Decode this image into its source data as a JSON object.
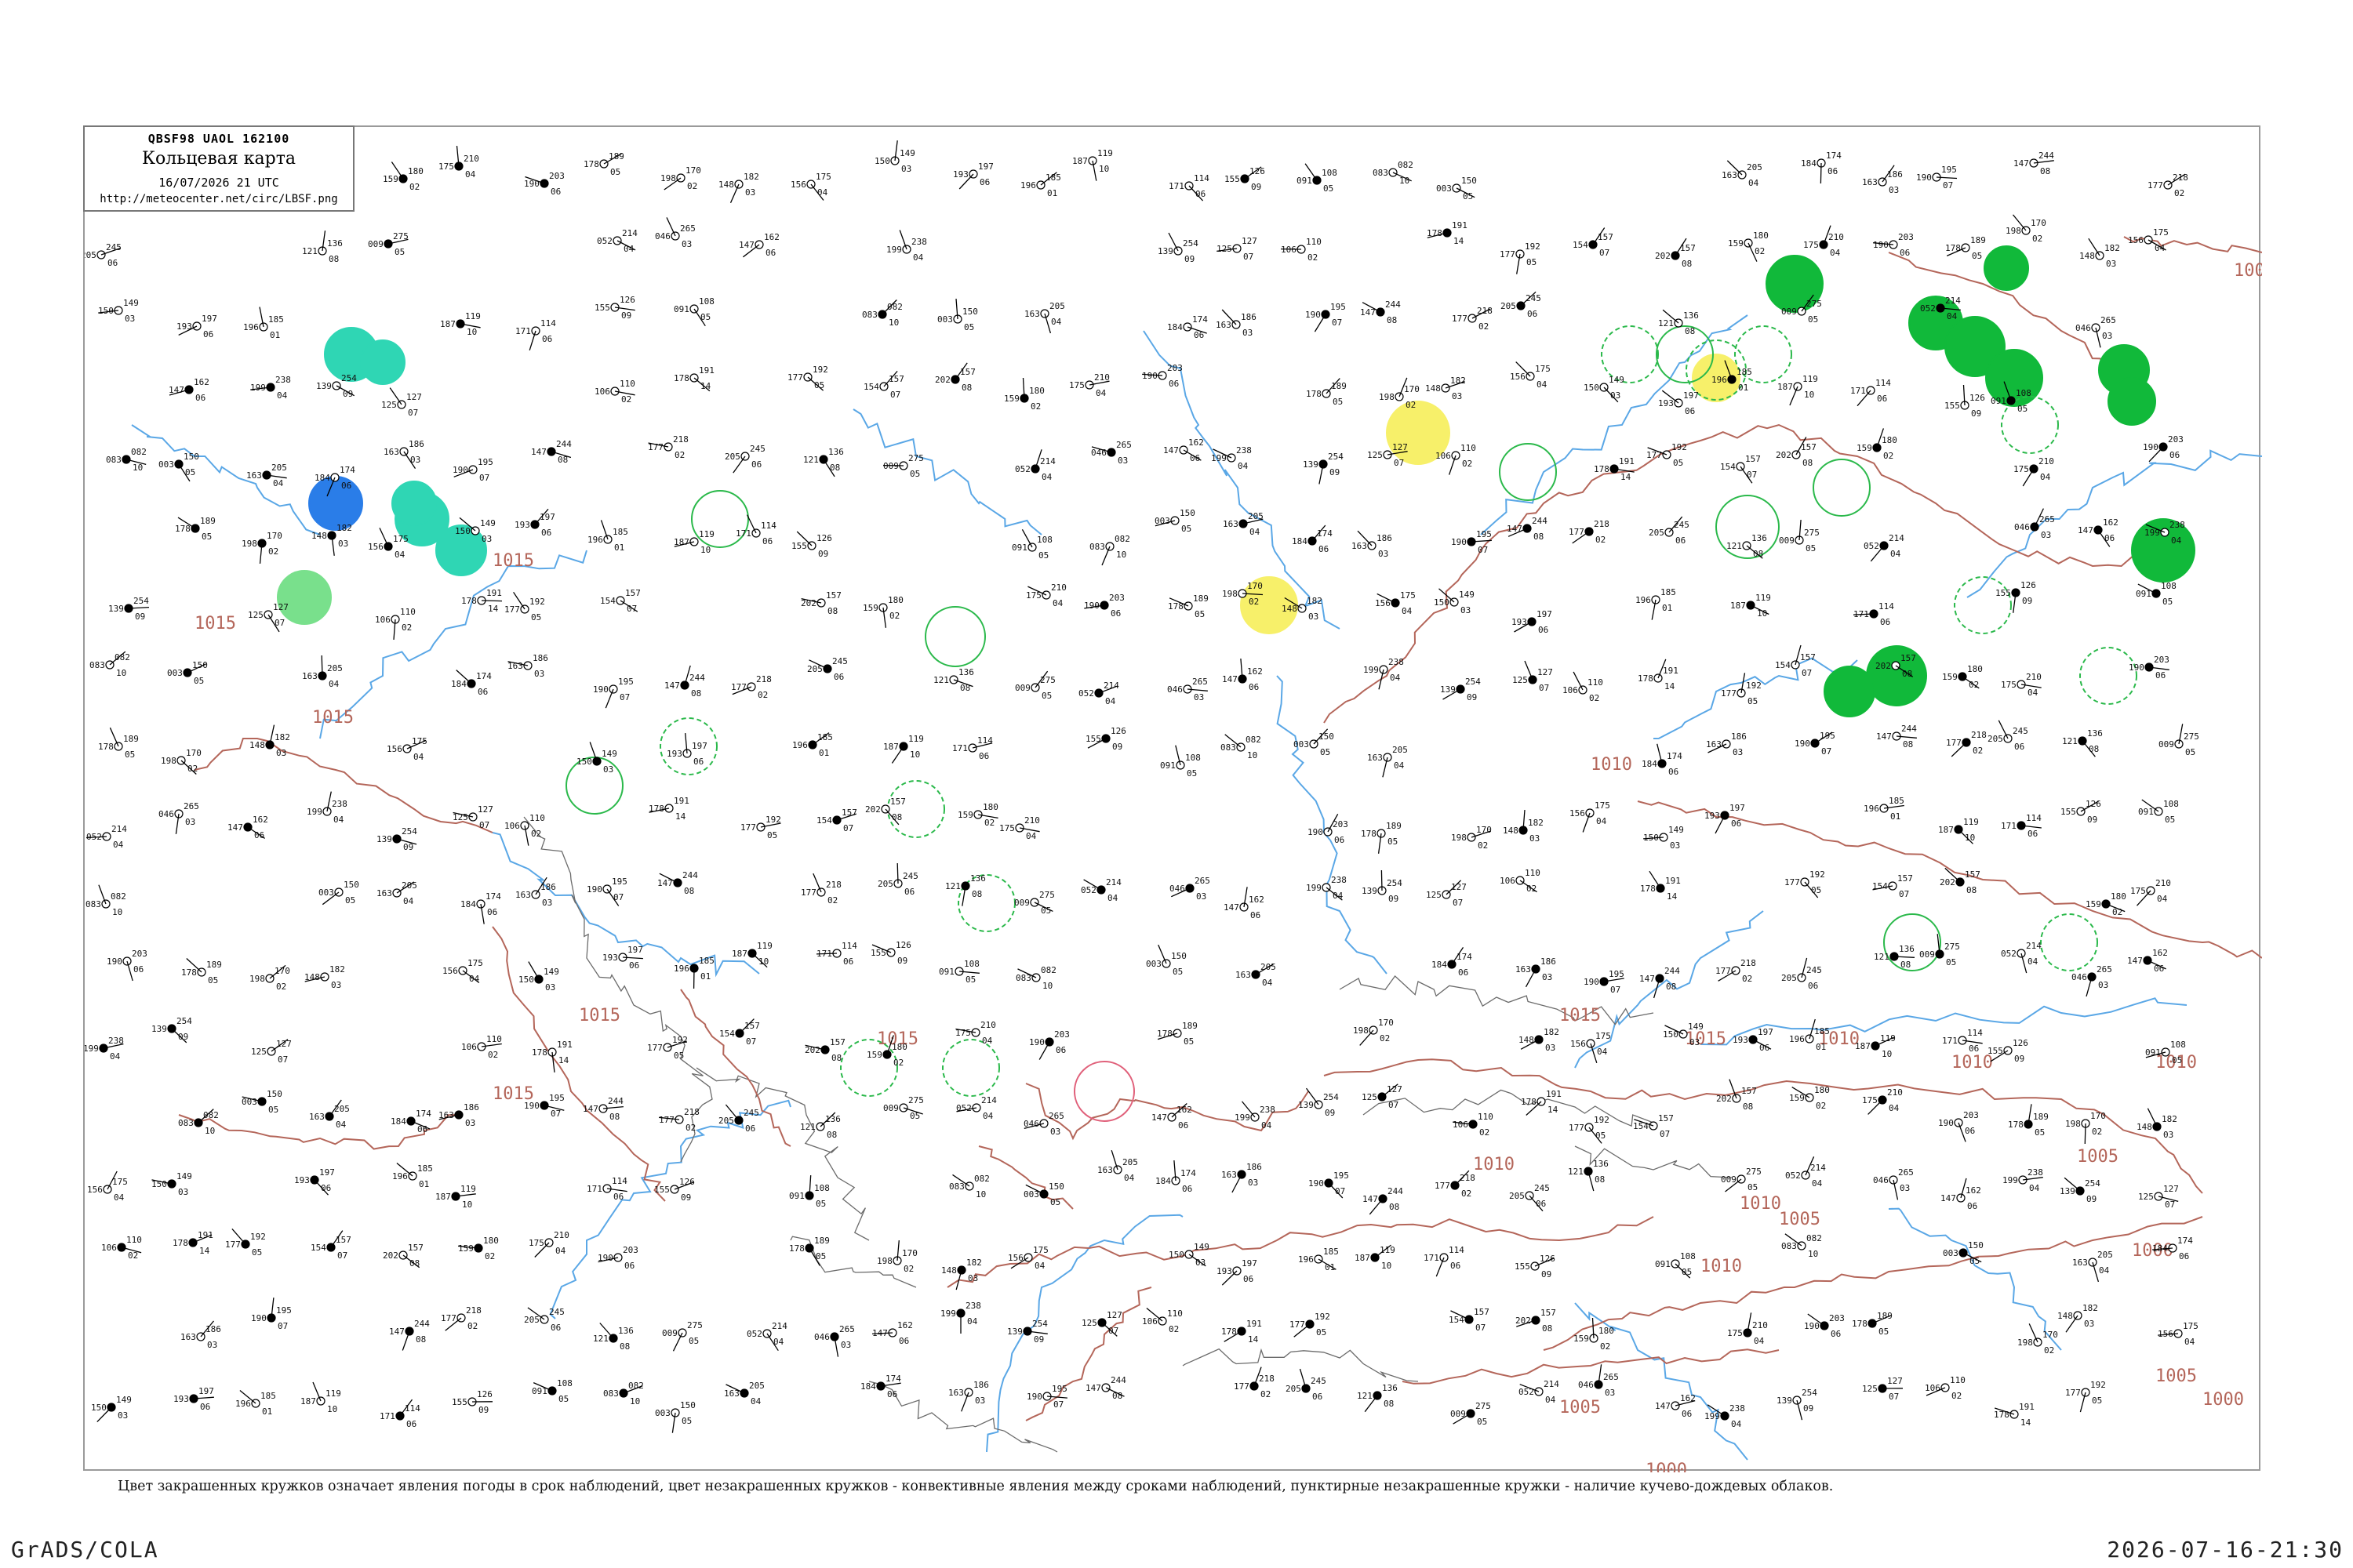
{
  "header": {
    "code_line": "QBSF98  UAOL  162100",
    "title": "Кольцевая карта",
    "datetime": "16/07/2026 21 UTC",
    "url": "http://meteocenter.net/circ/LBSF.png"
  },
  "caption": "Цвет закрашенных кружков означает явления погоды в срок наблюдений, цвет незакрашенных кружков - конвективные явления между сроками наблюдений, пунктирные незакрашенные кружки - наличие кучево-дождевых облаков.",
  "footer": {
    "software": "GrADS/COLA",
    "timestamp": "2026-07-16-21:30"
  },
  "colors": {
    "isobar": "#b4665a",
    "rivers": "#5aa7e6",
    "coast": "#6b6b6b",
    "station_text": "#111111",
    "station_id": "#8a8a8a",
    "rain_green": "#11b93a",
    "light_green": "#79e08c",
    "cyan_green": "#2fd6b4",
    "blue": "#2a7de8",
    "yellow": "#f7f06a",
    "thunder_circle_green": "#2bb94b",
    "pink": "#e0607a"
  },
  "isobar_labels": [
    "1000",
    "1015",
    "1015",
    "1015",
    "1015",
    "1015",
    "1015",
    "1015",
    "1015",
    "1010",
    "1010",
    "1010",
    "1010",
    "1010",
    "1010",
    "1010",
    "1005",
    "1005",
    "1005",
    "1005",
    "1000",
    "1000",
    "1000"
  ],
  "stations": [
    {
      "p": "191",
      "t": "178",
      "d": "14"
    },
    {
      "p": "192",
      "t": "177",
      "d": "05"
    },
    {
      "p": "157",
      "t": "154",
      "d": "07"
    },
    {
      "p": "157",
      "t": "202",
      "d": "08"
    },
    {
      "p": "180",
      "t": "159",
      "d": "02"
    },
    {
      "p": "210",
      "t": "175",
      "d": "04"
    },
    {
      "p": "203",
      "t": "190",
      "d": "06"
    },
    {
      "p": "189",
      "t": "178",
      "d": "05"
    },
    {
      "p": "170",
      "t": "198",
      "d": "02"
    },
    {
      "p": "182",
      "t": "148",
      "d": "03"
    },
    {
      "p": "175",
      "t": "156",
      "d": "04"
    },
    {
      "p": "149",
      "t": "150",
      "d": "03"
    },
    {
      "p": "197",
      "t": "193",
      "d": "06"
    },
    {
      "p": "185",
      "t": "196",
      "d": "01"
    },
    {
      "p": "119",
      "t": "187",
      "d": "10"
    },
    {
      "p": "114",
      "t": "171",
      "d": "06"
    },
    {
      "p": "126",
      "t": "155",
      "d": "09"
    },
    {
      "p": "108",
      "t": "091",
      "d": "05"
    },
    {
      "p": "082",
      "t": "083",
      "d": "10"
    },
    {
      "p": "150",
      "t": "003",
      "d": "05"
    },
    {
      "p": "205",
      "t": "163",
      "d": "04"
    },
    {
      "p": "174",
      "t": "184",
      "d": "06"
    },
    {
      "p": "186",
      "t": "163",
      "d": "03"
    },
    {
      "p": "195",
      "t": "190",
      "d": "07"
    },
    {
      "p": "244",
      "t": "147",
      "d": "08"
    },
    {
      "p": "218",
      "t": "177",
      "d": "02"
    },
    {
      "p": "245",
      "t": "205",
      "d": "06"
    },
    {
      "p": "136",
      "t": "121",
      "d": "08"
    },
    {
      "p": "275",
      "t": "009",
      "d": "05"
    },
    {
      "p": "214",
      "t": "052",
      "d": "04"
    },
    {
      "p": "265",
      "t": "046",
      "d": "03"
    },
    {
      "p": "162",
      "t": "147",
      "d": "06"
    },
    {
      "p": "238",
      "t": "199",
      "d": "04"
    },
    {
      "p": "254",
      "t": "139",
      "d": "09"
    },
    {
      "p": "127",
      "t": "125",
      "d": "07"
    },
    {
      "p": "110",
      "t": "106",
      "d": "02"
    }
  ]
}
